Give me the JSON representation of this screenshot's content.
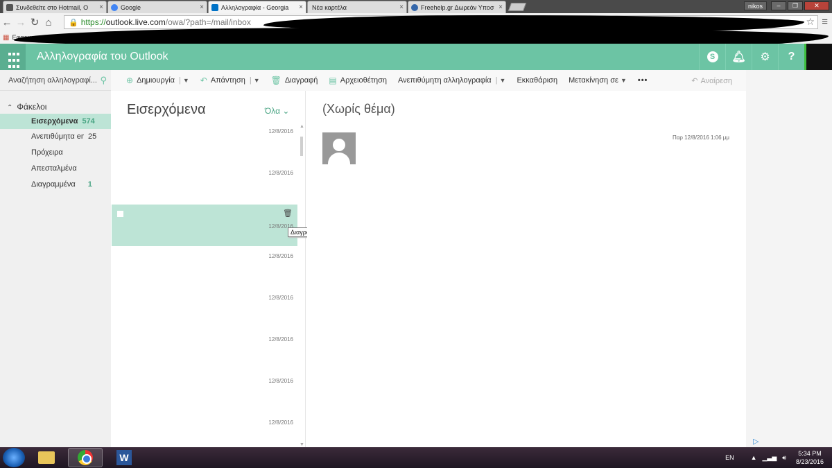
{
  "browser": {
    "tabs": [
      {
        "title": "Συνδεθείτε στο Hotmail, O",
        "favicon_color": "#555555"
      },
      {
        "title": "Google",
        "favicon_color": "#4285f4"
      },
      {
        "title": "Αλληλογραφία - Georgia",
        "favicon_color": "#0072c6"
      },
      {
        "title": "Νέα καρτέλα",
        "favicon_color": "#cccccc"
      },
      {
        "title": "Freehelp.gr Δωρεάν Υποσ",
        "favicon_color": "#3366aa"
      }
    ],
    "user_chip": "nikos",
    "url_scheme": "https://",
    "url_host": "outlook.live.com",
    "url_path": "/owa/?path=/mail/inbox",
    "bookmarks_label": "Εφαρμο"
  },
  "outlook": {
    "app_title": "Αλληλογραφία του Outlook",
    "accent_color": "#6cc4a4",
    "header_icons": [
      "skype-icon",
      "bell-icon",
      "gear-icon",
      "help-icon"
    ],
    "help_label": "?",
    "skype_label": "S",
    "search": {
      "placeholder": "Αναζήτηση αλληλογραφί..."
    },
    "toolbar": {
      "new_label": "Δημιουργία",
      "reply_label": "Απάντηση",
      "delete_label": "Διαγραφή",
      "archive_label": "Αρχειοθέτηση",
      "junk_label": "Ανεπιθύμητη αλληλογραφία",
      "sweep_label": "Εκκαθάριση",
      "move_label": "Μετακίνηση σε",
      "more_label": "•••",
      "undo_label": "Αναίρεση"
    },
    "folders": {
      "header": "Φάκελοι",
      "items": [
        {
          "name": "Εισερχόμενα",
          "count": "574"
        },
        {
          "name": "Ανεπιθύμητα email",
          "count": "25"
        },
        {
          "name": "Πρόχειρα",
          "count": ""
        },
        {
          "name": "Απεσταλμένα",
          "count": ""
        },
        {
          "name": "Διαγραμμένα",
          "count": "1"
        }
      ]
    },
    "message_list": {
      "title": "Εισερχόμενα",
      "filter": "Όλα",
      "rows": [
        {
          "date": "12/8/2016"
        },
        {
          "date": "12/8/2016"
        },
        {
          "date": "12/8/2016"
        },
        {
          "date": "12/8/2016"
        },
        {
          "date": "12/8/2016"
        },
        {
          "date": "12/8/2016"
        },
        {
          "date": "12/8/2016"
        },
        {
          "date": "12/8/2016"
        }
      ],
      "tooltip": "Διαγραφή"
    },
    "reading_pane": {
      "subject": "(Χωρίς θέμα)",
      "date": "Παρ 12/8/2016 1:06 μμ"
    }
  },
  "taskbar": {
    "language": "EN",
    "time": "5:34 PM",
    "date": "8/23/2016",
    "word_label": "W"
  }
}
